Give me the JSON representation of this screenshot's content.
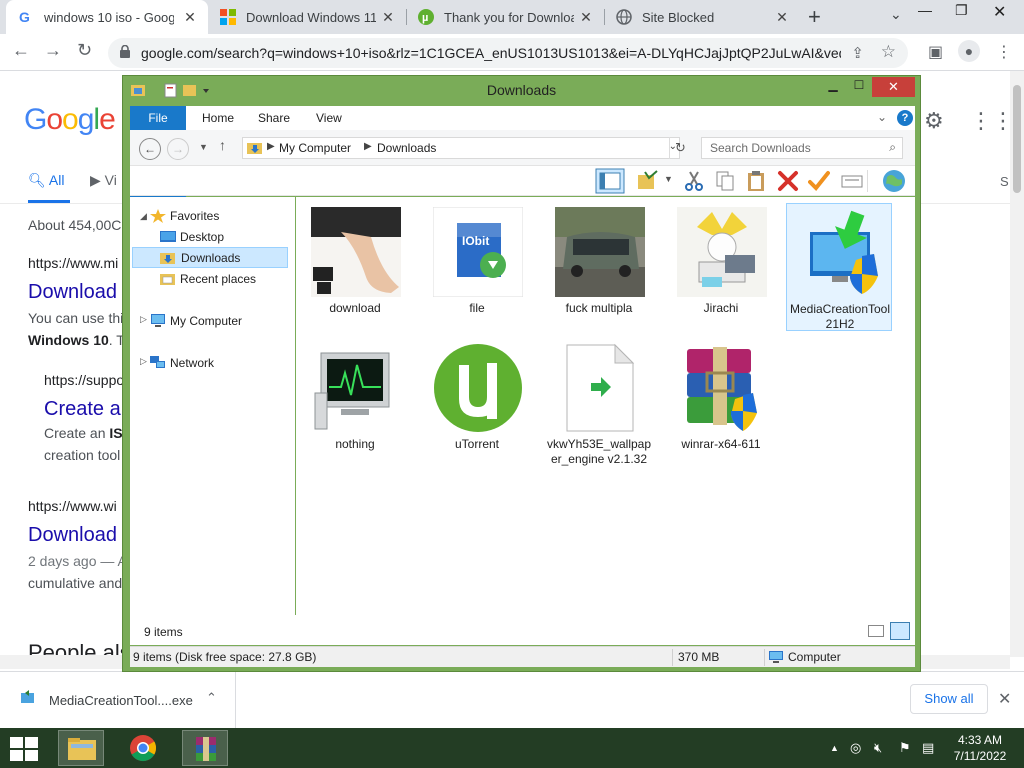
{
  "browser": {
    "tabs": [
      {
        "title": "windows 10 iso - Google",
        "icon": "google-g-icon",
        "active": true
      },
      {
        "title": "Download Windows 11",
        "icon": "microsoft-logo-icon",
        "active": false
      },
      {
        "title": "Thank you for Download",
        "icon": "utorrent-icon",
        "active": false
      },
      {
        "title": "Site Blocked",
        "icon": "globe-icon",
        "active": false
      }
    ],
    "url": "google.com/search?q=windows+10+iso&rlz=1C1GCEA_enUS1013US1013&ei=A-DLYqHCJajJptQP2JuLwAI&ved..."
  },
  "google": {
    "logo": "Google",
    "tabs": [
      {
        "label": "All"
      },
      {
        "label": "Vi"
      }
    ],
    "right_tab_fragment": "S",
    "results_count": "About 454,00C",
    "results": [
      {
        "cite": "https://www.mi",
        "title": "Download",
        "snippet1": "You can use thi",
        "snippet2_bold": "Windows 10",
        "snippet2": ". Tl"
      },
      {
        "cite": "https://suppo",
        "title": "Create ar",
        "snippet1_pre": "Create an ",
        "snippet1_bold": "ISO",
        "snippet2": "creation tool"
      },
      {
        "cite": "https://www.wi",
        "title": "Download",
        "snippet1": "2 days ago — A",
        "snippet2": "cumulative and"
      }
    ],
    "people_also": "People als"
  },
  "downloads_bar": {
    "file": "MediaCreationTool....exe",
    "show_all": "Show all"
  },
  "explorer": {
    "title": "Downloads",
    "ribbon_tabs": [
      "File",
      "Home",
      "Share",
      "View"
    ],
    "breadcrumb": [
      "My Computer",
      "Downloads"
    ],
    "search_placeholder": "Search Downloads",
    "nav": {
      "favorites": "Favorites",
      "desktop": "Desktop",
      "downloads": "Downloads",
      "recent": "Recent places",
      "computer": "My Computer",
      "network": "Network"
    },
    "files": [
      {
        "name": "download",
        "icon": "foot-photo-thumbnail"
      },
      {
        "name": "file",
        "icon": "iobit-installer-icon"
      },
      {
        "name": "fuck multipla",
        "icon": "car-photo-thumbnail"
      },
      {
        "name": "Jirachi",
        "icon": "jirachi-image-thumbnail"
      },
      {
        "name": "MediaCreationTool21H2",
        "icon": "media-creation-tool-icon",
        "selected": true
      },
      {
        "name": "nothing",
        "icon": "system-monitor-icon"
      },
      {
        "name": "uTorrent",
        "icon": "utorrent-icon"
      },
      {
        "name": "vkwYh53E_wallpaper_engine v2.1.32",
        "icon": "generic-exe-file-icon"
      },
      {
        "name": "winrar-x64-611",
        "icon": "winrar-installer-icon"
      }
    ],
    "item_count": "9 items",
    "status_left": "9 items (Disk free space: 27.8 GB)",
    "status_size": "370 MB",
    "status_location": "Computer"
  },
  "taskbar": {
    "time": "4:33 AM",
    "date": "7/11/2022"
  },
  "colors": {
    "google_blue": "#4285F4",
    "google_red": "#EA4335",
    "google_yellow": "#FBBC05",
    "google_green": "#34A853",
    "link": "#1a0dab",
    "window_frame": "#7aac58",
    "taskbar": "#233d24",
    "ribbon_file": "#1979ca"
  }
}
